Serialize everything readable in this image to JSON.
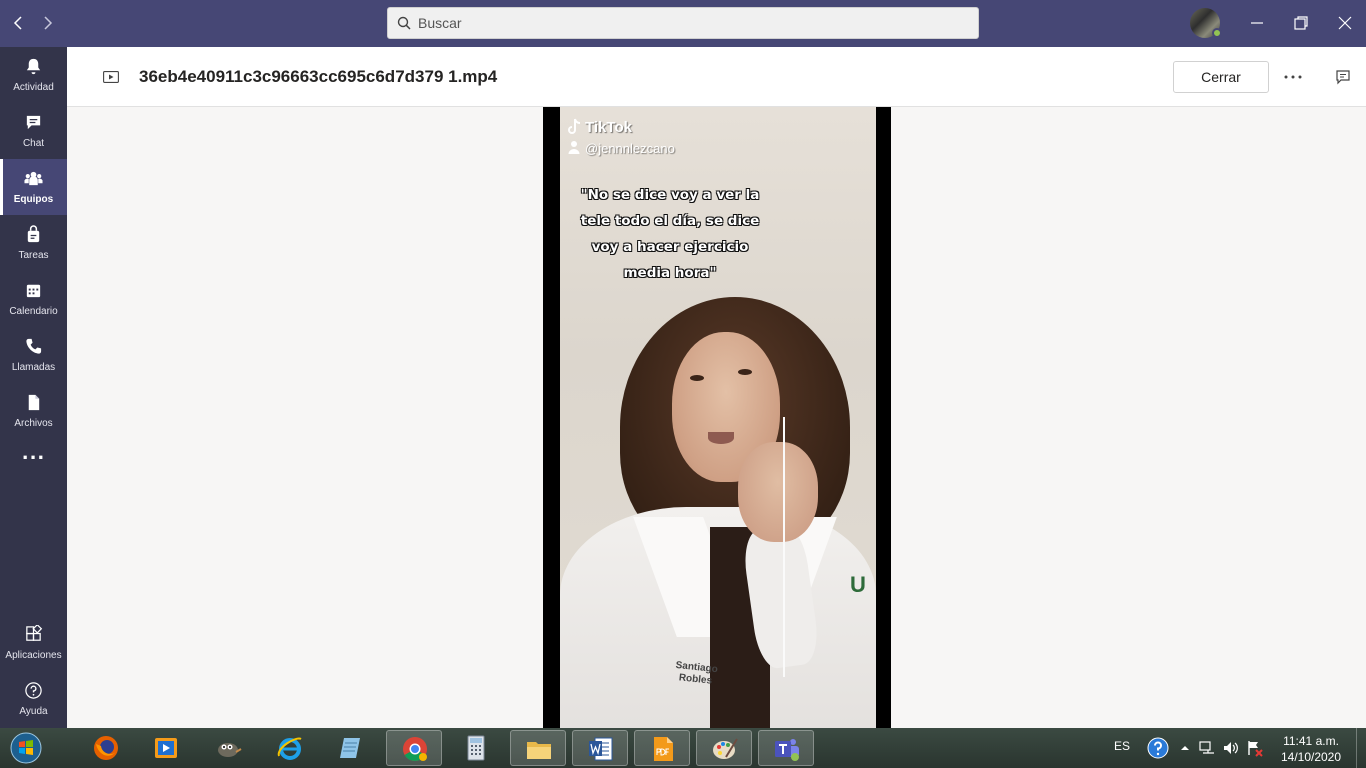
{
  "search": {
    "placeholder": "Buscar"
  },
  "sidebar": {
    "items": [
      {
        "label": "Actividad",
        "icon": "bell-icon"
      },
      {
        "label": "Chat",
        "icon": "chat-icon"
      },
      {
        "label": "Equipos",
        "icon": "teams-icon",
        "active": true
      },
      {
        "label": "Tareas",
        "icon": "assignments-icon"
      },
      {
        "label": "Calendario",
        "icon": "calendar-icon"
      },
      {
        "label": "Llamadas",
        "icon": "phone-icon"
      },
      {
        "label": "Archivos",
        "icon": "files-icon"
      }
    ],
    "more": "...",
    "apps_label": "Aplicaciones",
    "help_label": "Ayuda"
  },
  "header": {
    "file_name": "36eb4e40911c3c96663cc695c6d7d379 1.mp4",
    "close_label": "Cerrar"
  },
  "video": {
    "brand": "TikTok",
    "username": "@jennnlezcano",
    "caption_lines": [
      "\"No se dice voy a ver la",
      "tele todo el día, se dice",
      "voy a hacer ejercicio",
      "media hora\""
    ],
    "coat_logo": "U",
    "name_tag": [
      "Santiago",
      "Robles"
    ]
  },
  "taskbar": {
    "apps": [
      "start-icon",
      "firefox-icon",
      "media-player-icon",
      "gimp-icon",
      "internet-explorer-icon",
      "notes-icon",
      "chrome-icon",
      "calculator-icon",
      "file-explorer-icon",
      "word-icon",
      "pdf-icon",
      "paint-icon",
      "teams-icon"
    ],
    "language": "ES",
    "time": "11:41 a.m.",
    "date": "14/10/2020"
  },
  "colors": {
    "titlebar": "#464775",
    "sidebar": "#33344a",
    "accent": "#6264a7"
  }
}
